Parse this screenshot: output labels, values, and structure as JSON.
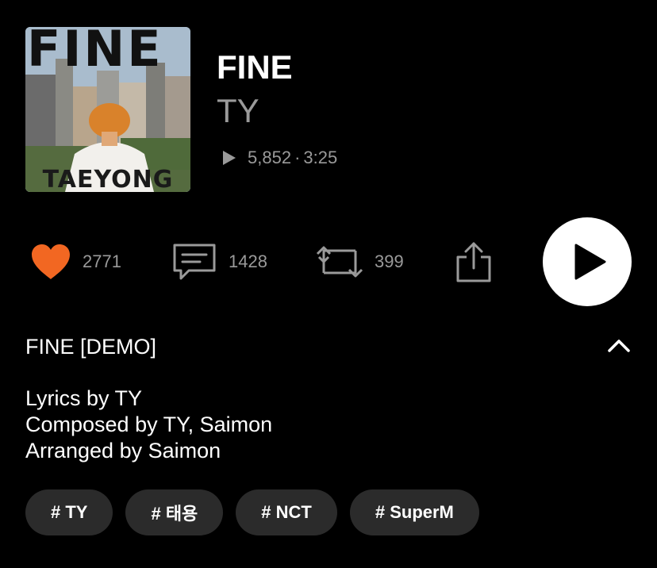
{
  "track": {
    "artwork": {
      "title_text": "FINE",
      "artist_text": "TAEYONG"
    },
    "title": "FINE",
    "artist": "TY",
    "play_icon": "play-triangle-icon",
    "plays": "5,852",
    "separator": "·",
    "duration": "3:25"
  },
  "actions": {
    "like": {
      "icon": "heart-icon",
      "count": "2771",
      "color": "#f26722"
    },
    "comment": {
      "icon": "comment-icon",
      "count": "1428"
    },
    "repost": {
      "icon": "repost-icon",
      "count": "399"
    },
    "share": {
      "icon": "share-icon"
    },
    "play": {
      "icon": "play-icon"
    }
  },
  "description": {
    "title": "FINE [DEMO]",
    "collapse_icon": "chevron-up-icon",
    "credits": [
      "Lyrics by TY",
      "Composed by TY, Saimon",
      "Arranged by Saimon"
    ]
  },
  "tags": [
    "# TY",
    "# 태용",
    "# NCT",
    "# SuperM"
  ],
  "colors": {
    "background": "#000000",
    "muted_text": "#9a9a9a",
    "tag_background": "#2b2b2b",
    "accent": "#f26722"
  }
}
